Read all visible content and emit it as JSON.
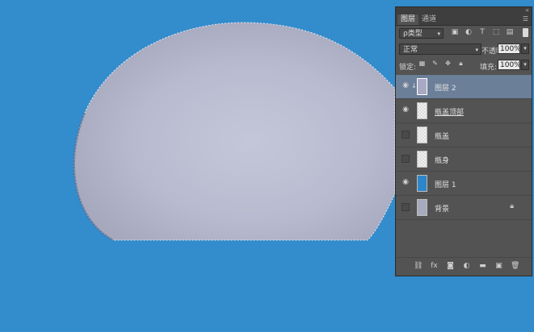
{
  "colors": {
    "canvas_background": "#338ccb",
    "bottle_fill": "#bbbdd3",
    "panel_background": "#535353",
    "selected_layer": "#6b7f99"
  },
  "panel": {
    "tabs": [
      {
        "label": "图层",
        "active": true
      },
      {
        "label": "通道",
        "active": false
      }
    ],
    "filter": {
      "kind_label": "ρ类型",
      "icons": [
        "image-filter-icon",
        "adjustment-filter-icon",
        "type-filter-icon",
        "shape-filter-icon",
        "smart-object-filter-icon"
      ]
    },
    "blend_mode": "正常",
    "opacity_label": "不透明度:",
    "opacity_value": "100%",
    "lock_label": "锁定:",
    "lock_icons": [
      "lock-transparent-icon",
      "lock-paint-icon",
      "lock-move-icon",
      "lock-all-icon"
    ],
    "fill_label": "填充:",
    "fill_value": "100%",
    "layers": [
      {
        "name": "图层 2",
        "visible": true,
        "selected": true,
        "thumb": "gray",
        "clipped": true
      },
      {
        "name": "瓶盖顶部",
        "visible": true,
        "selected": false,
        "thumb": "transparent",
        "underline": true
      },
      {
        "name": "瓶盖",
        "visible": false,
        "selected": false,
        "thumb": "transparent"
      },
      {
        "name": "瓶身",
        "visible": false,
        "selected": false,
        "thumb": "transparent"
      },
      {
        "name": "图层 1",
        "visible": true,
        "selected": false,
        "thumb": "blue"
      },
      {
        "name": "背景",
        "visible": false,
        "selected": false,
        "thumb": "bg",
        "locked": true
      }
    ],
    "bottom_icons": [
      "link-layers-icon",
      "fx-icon",
      "layer-mask-icon",
      "adjustment-layer-icon",
      "new-group-icon",
      "new-layer-icon",
      "delete-layer-icon"
    ]
  }
}
